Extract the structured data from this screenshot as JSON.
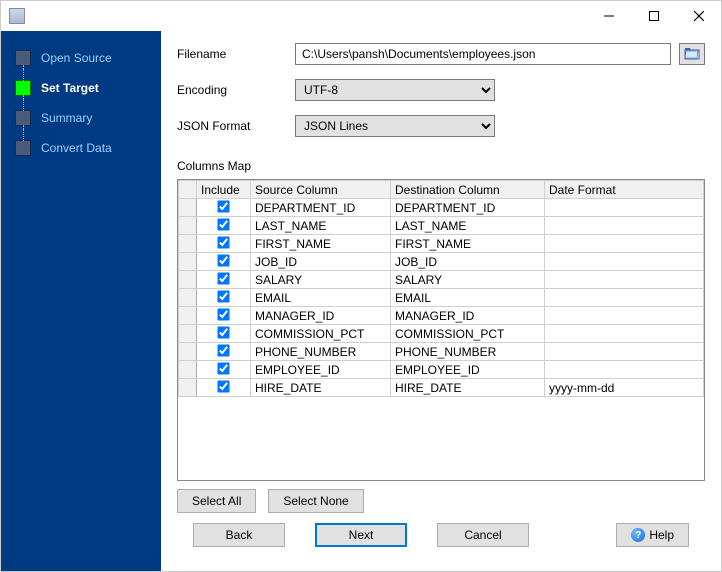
{
  "sidebar": {
    "items": [
      {
        "label": "Open Source",
        "active": false
      },
      {
        "label": "Set Target",
        "active": true
      },
      {
        "label": "Summary",
        "active": false
      },
      {
        "label": "Convert Data",
        "active": false
      }
    ]
  },
  "form": {
    "filename_label": "Filename",
    "filename_value": "C:\\Users\\pansh\\Documents\\employees.json",
    "encoding_label": "Encoding",
    "encoding_value": "UTF-8",
    "json_format_label": "JSON Format",
    "json_format_value": "JSON Lines"
  },
  "columns": {
    "section_label": "Columns Map",
    "headers": {
      "include": "Include",
      "source": "Source Column",
      "destination": "Destination Column",
      "dateformat": "Date Format"
    },
    "rows": [
      {
        "include": true,
        "source": "DEPARTMENT_ID",
        "destination": "DEPARTMENT_ID",
        "dateformat": ""
      },
      {
        "include": true,
        "source": "LAST_NAME",
        "destination": "LAST_NAME",
        "dateformat": ""
      },
      {
        "include": true,
        "source": "FIRST_NAME",
        "destination": "FIRST_NAME",
        "dateformat": ""
      },
      {
        "include": true,
        "source": "JOB_ID",
        "destination": "JOB_ID",
        "dateformat": ""
      },
      {
        "include": true,
        "source": "SALARY",
        "destination": "SALARY",
        "dateformat": ""
      },
      {
        "include": true,
        "source": "EMAIL",
        "destination": "EMAIL",
        "dateformat": ""
      },
      {
        "include": true,
        "source": "MANAGER_ID",
        "destination": "MANAGER_ID",
        "dateformat": ""
      },
      {
        "include": true,
        "source": "COMMISSION_PCT",
        "destination": "COMMISSION_PCT",
        "dateformat": ""
      },
      {
        "include": true,
        "source": "PHONE_NUMBER",
        "destination": "PHONE_NUMBER",
        "dateformat": ""
      },
      {
        "include": true,
        "source": "EMPLOYEE_ID",
        "destination": "EMPLOYEE_ID",
        "dateformat": ""
      },
      {
        "include": true,
        "source": "HIRE_DATE",
        "destination": "HIRE_DATE",
        "dateformat": "yyyy-mm-dd"
      }
    ]
  },
  "buttons": {
    "select_all": "Select All",
    "select_none": "Select None",
    "back": "Back",
    "next": "Next",
    "cancel": "Cancel",
    "help": "Help"
  }
}
